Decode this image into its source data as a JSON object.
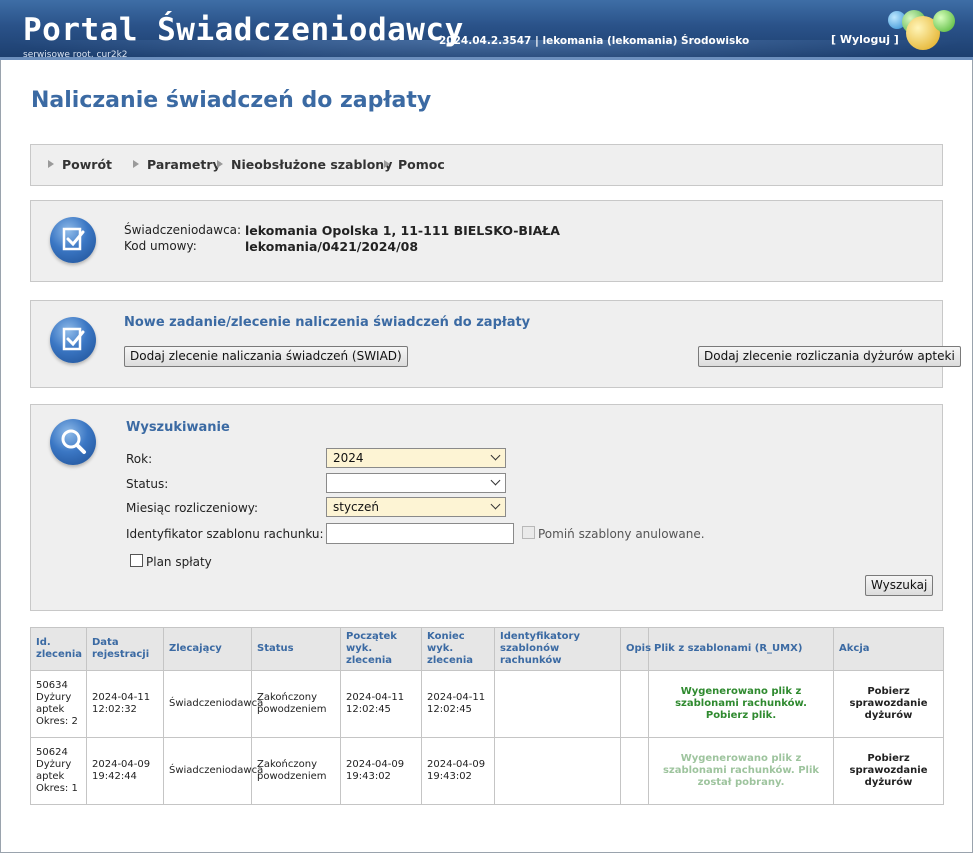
{
  "header": {
    "portal_title": "Portal Świadczeniodawcy",
    "service_tag": "serwisowe root, cur2k2",
    "version_info": "2024.04.2.3547 | lekomania (lekomania) Środowisko",
    "logout": "[ Wyloguj ]"
  },
  "page_title": "Naliczanie świadczeń do zapłaty",
  "nav": {
    "back": "Powrót",
    "params": "Parametry",
    "unhandled": "Nieobsłużone szablony",
    "help": "Pomoc"
  },
  "provider": {
    "provider_label": "Świadczeniodawca:",
    "provider_value": "lekomania Opolska 1, 11-111 BIELSKO-BIAŁA",
    "contract_label": "Kod umowy:",
    "contract_value": "lekomania/0421/2024/08"
  },
  "new_task": {
    "title": "Nowe zadanie/zlecenie naliczenia świadczeń do zapłaty",
    "add_swiad_button": "Dodaj zlecenie naliczania świadczeń (SWIAD)",
    "add_duty_button": "Dodaj zlecenie rozliczania dyżurów apteki"
  },
  "search": {
    "title": "Wyszukiwanie",
    "year_label": "Rok:",
    "year_value": "2024",
    "status_label": "Status:",
    "status_value": "",
    "month_label": "Miesiąc rozliczeniowy:",
    "month_value": "styczeń",
    "template_id_label": "Identyfikator szablonu rachunku:",
    "template_id_value": "",
    "skip_cancelled_label": "Pomiń szablony anulowane.",
    "payment_plan_label": "Plan spłaty",
    "search_button": "Wyszukaj"
  },
  "table": {
    "columns": {
      "id": "Id. zlecenia",
      "reg_date": "Data rejestracji",
      "requester": "Zlecający",
      "status": "Status",
      "start": "Początek wyk. zlecenia",
      "end": "Koniec wyk. zlecenia",
      "template_ids": "Identyfikatory szablonów rachunków",
      "desc": "Opis",
      "file": "Plik z szablonami (R_UMX)",
      "action": "Akcja"
    },
    "rows": [
      {
        "id": "50634 Dyżury aptek Okres: 2",
        "reg_date": "2024-04-11 12:02:32",
        "requester": "Świadczeniodawca",
        "status": "Zakończony powodzeniem",
        "start": "2024-04-11 12:02:45",
        "end": "2024-04-11 12:02:45",
        "template_ids": "",
        "desc": "",
        "file": "Wygenerowano plik z szablonami rachunków. Pobierz plik.",
        "action": "Pobierz sprawozdanie dyżurów"
      },
      {
        "id": "50624 Dyżury aptek Okres: 1",
        "reg_date": "2024-04-09 19:42:44",
        "requester": "Świadczeniodawca",
        "status": "Zakończony powodzeniem",
        "start": "2024-04-09 19:43:02",
        "end": "2024-04-09 19:43:02",
        "template_ids": "",
        "desc": "",
        "file": "Wygenerowano plik z szablonami rachunków. Plik został pobrany.",
        "action": "Pobierz sprawozdanie dyżurów"
      }
    ]
  },
  "colors": {
    "header": "#2a5289",
    "title_blue": "#3b6aa3",
    "file_active": "#2f8a2f",
    "file_used": "#9ec49e",
    "select_highlight": "#fdf4d4"
  }
}
